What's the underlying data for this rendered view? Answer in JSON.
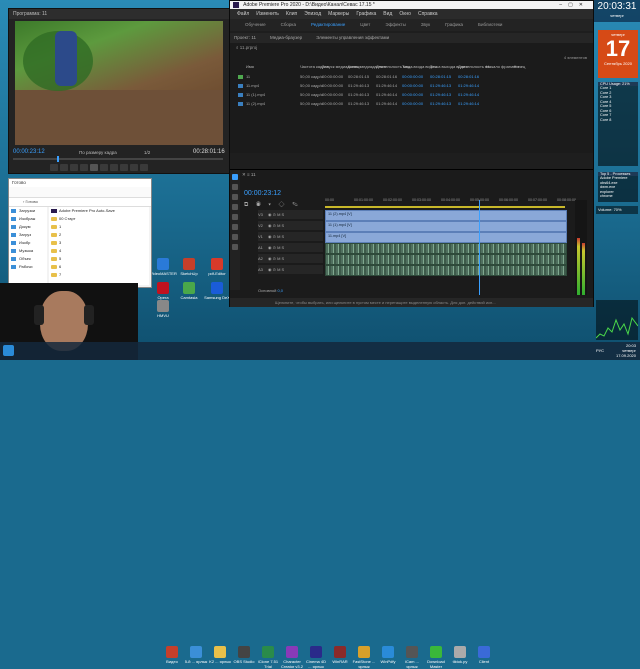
{
  "program": {
    "title": "Программа: 11",
    "timecode": "00:00:23:12",
    "fit": "По размеру кадра",
    "ratio": "1/2",
    "duration": "00:28:01:16"
  },
  "premiere": {
    "title": "Adobe Premiere Pro 2020 - D:\\Видео\\Канал\\Севас 17.15 *",
    "menu": [
      "Файл",
      "Изменить",
      "Клип",
      "Эпизод",
      "Маркеры",
      "Графика",
      "Вид",
      "Окно",
      "Справка"
    ],
    "workspaces": [
      "Обучение",
      "Сборка",
      "Редактирование",
      "Цвет",
      "Эффекты",
      "Звук",
      "Графика",
      "Библиотеки"
    ],
    "active_workspace": "Редактирование",
    "project_tabs": [
      "Проект: 11",
      "Медиа-браузер",
      "Элементы управления эффектами"
    ],
    "project_count": "4 элементов",
    "columns": [
      "Имя",
      "Частота кадров",
      "Запуск медиаданных",
      "Конец медиаданных",
      "Длительность мед...",
      "Точка входа видео",
      "Точка выхода видео",
      "Длительность ви...",
      "Начало фрагмент...",
      "Конец"
    ],
    "items": [
      {
        "name": "11",
        "fps": "50,00 кадр/с",
        "start": "00:00:00:00",
        "end": "00:28:01:15",
        "dur": "00:28:01:16",
        "in": "00:00:00:00",
        "out": "00:28:01:15",
        "vdur": "00:28:01:16",
        "color": "#4fa84f"
      },
      {
        "name": "11.mp4",
        "fps": "50,00 кадр/с",
        "start": "00:00:00:00",
        "end": "01:29:46:13",
        "dur": "01:29:46:14",
        "in": "00:00:00:00",
        "out": "01:29:46:13",
        "vdur": "01:29:46:14",
        "color": "#3a7fbf"
      },
      {
        "name": "11 (1).mp4",
        "fps": "50,00 кадр/с",
        "start": "00:00:00:00",
        "end": "01:29:46:13",
        "dur": "01:29:46:14",
        "in": "00:00:00:00",
        "out": "01:29:46:13",
        "vdur": "01:29:46:14",
        "color": "#3a7fbf"
      },
      {
        "name": "11 (2).mp4",
        "fps": "50,00 кадр/с",
        "start": "00:00:00:00",
        "end": "01:29:46:13",
        "dur": "01:29:46:14",
        "in": "00:00:00:00",
        "out": "01:29:46:13",
        "vdur": "01:29:46:14",
        "color": "#3a7fbf"
      }
    ],
    "timeline": {
      "sequence": "11",
      "timecode": "00:00:23:12",
      "ruler": [
        "00:00",
        "00:01:00:00",
        "00:02:00:00",
        "00:03:00:00",
        "00:04:00:00",
        "00:05:00:00",
        "00:06:00:00",
        "00:07:00:00",
        "00:08:00:00"
      ],
      "tracks": [
        "V3",
        "V2",
        "V1",
        "A1",
        "A2",
        "A3"
      ],
      "clip_labels": [
        "11 (2).mp4 [V]",
        "11 (1).mp4 [V]",
        "11.mp4 [V]"
      ],
      "master": "Основной",
      "master_value": "0,0",
      "status": "Щелкните, чтобы выбрать, или щелкните в пустом месте и перетащите выделенную область. Для доп. действий исп..."
    }
  },
  "explorer": {
    "title": "Готово",
    "address": "Готово",
    "nav": [
      "Загрузки",
      "Изображ",
      "Докум",
      "Загруз",
      "Изобр",
      "Музыка",
      "Объек",
      "Рабочи"
    ],
    "files": [
      "Adobe Premiere Pro Auto-Save",
      "00 Старт",
      "1",
      "2",
      "3",
      "4",
      "5",
      "6",
      "7"
    ]
  },
  "desktop_icons": [
    {
      "label": "VideoMASTER",
      "color": "#2a7ad8"
    },
    {
      "label": "SketchUp",
      "color": "#c53f2a"
    },
    {
      "label": "pdf-Editor",
      "color": "#d83a2a"
    },
    {
      "label": "Opera",
      "color": "#c1121f"
    },
    {
      "label": "Samsung DeX",
      "color": "#1a5cd8"
    },
    {
      "label": "Camtasia",
      "color": "#4aa84a"
    },
    {
      "label": "HMVU",
      "color": "#888"
    },
    {
      "label": "Ключ Мотив",
      "color": "#777"
    },
    {
      "label": "Виктория",
      "color": "#7a3aa8"
    },
    {
      "label": "CCleaner",
      "color": "#2ab0e8"
    },
    {
      "label": "Steam",
      "color": "#1b2838"
    },
    {
      "label": "Gameloop",
      "color": "#2ae86a"
    }
  ],
  "taskbar": {
    "items": [
      "Видео",
      "5-й ... ярлык",
      "K2 ... ярлык",
      "OBS Studio",
      "iClone 7.51 Trial",
      "Character Creator v3.2",
      "Cinema 4D ... ярлык",
      "WinRAR",
      "FastStone ... ярлык",
      "WinPdfy",
      "iCam ... ярлык",
      "Download Master",
      "tiktok.py",
      "Client"
    ],
    "time": "20:03",
    "date": "17.09.2020",
    "day": "четверг",
    "lang": "РУС"
  },
  "clock": {
    "time": "20:03:31",
    "day": "четверг"
  },
  "calendar": {
    "day": "четверг",
    "num": "17",
    "month": "Сентябрь 2020"
  },
  "cpu": {
    "title": "CPU Usage: 21%",
    "lines": [
      "Core 1",
      "Core 2",
      "Core 3",
      "Core 4",
      "Core 5",
      "Core 6",
      "Core 7",
      "Core 8"
    ]
  },
  "top": {
    "title": "Top 5 - Processes",
    "lines": [
      "Adobe Premiere",
      "obs64.exe",
      "dwm.exe",
      "explorer",
      "chrome"
    ]
  },
  "volume": "Volume: 70%"
}
